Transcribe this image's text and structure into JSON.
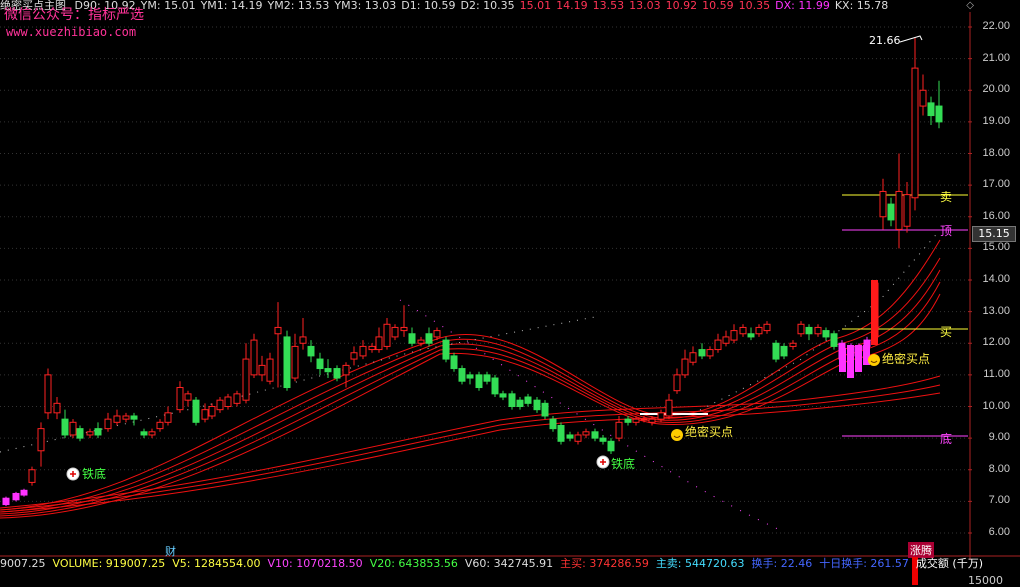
{
  "header": {
    "indicator_name": "绝密买点主图",
    "values": [
      {
        "label": "D90: 10.92",
        "color": "#dddddd"
      },
      {
        "label": "YM: 15.01",
        "color": "#dddddd"
      },
      {
        "label": "YM1: 14.19",
        "color": "#dddddd"
      },
      {
        "label": "YM2: 13.53",
        "color": "#dddddd"
      },
      {
        "label": "YM3: 13.03",
        "color": "#dddddd"
      },
      {
        "label": "D1: 10.59",
        "color": "#dddddd"
      },
      {
        "label": "D2: 10.35",
        "color": "#dddddd"
      },
      {
        "label": "15.01",
        "color": "#ff3355"
      },
      {
        "label": "14.19",
        "color": "#ff3355"
      },
      {
        "label": "13.53",
        "color": "#ff3355"
      },
      {
        "label": "13.03",
        "color": "#ff3355"
      },
      {
        "label": "10.92",
        "color": "#ff3355"
      },
      {
        "label": "10.59",
        "color": "#ff3355"
      },
      {
        "label": "10.35",
        "color": "#ff3355"
      },
      {
        "label": "DX: 11.99",
        "color": "#ff33ff"
      },
      {
        "label": "KX: 15.78",
        "color": "#dddddd"
      }
    ]
  },
  "watermark": {
    "line1": "微信公众号：指标严选",
    "line2": "www.xuezhibiao.com"
  },
  "corner_icon": "diamond-icon",
  "y_axis": {
    "ticks": [
      "22.00",
      "21.00",
      "20.00",
      "19.00",
      "18.00",
      "17.00",
      "16.00",
      "15.00",
      "14.00",
      "13.00",
      "12.00",
      "11.00",
      "10.00",
      "9.00",
      "8.00",
      "7.00",
      "6.00"
    ],
    "current_price": "15.15"
  },
  "annotations": {
    "peak": "21.66",
    "sell": "卖",
    "top": "顶",
    "buy": "买",
    "bottom": "底",
    "tiedi": "铁底",
    "buypoint": "绝密买点"
  },
  "colors": {
    "up": "#ff2222",
    "down": "#33dd55",
    "ma": "#ff1111",
    "magenta": "#ff33ff",
    "yellow": "#ffff33"
  },
  "footer": {
    "items": [
      {
        "label": "9007.25",
        "color": "#dddddd"
      },
      {
        "label": "VOLUME: 919007.25",
        "color": "#ffff44"
      },
      {
        "label": "V5: 1284554.00",
        "color": "#ffff44"
      },
      {
        "label": "V10: 1070218.50",
        "color": "#ff44ff"
      },
      {
        "label": "V20: 643853.56",
        "color": "#44ff44"
      },
      {
        "label": "V60: 342745.91",
        "color": "#dddddd"
      },
      {
        "label": "主买: 374286.59",
        "color": "#ff3333"
      },
      {
        "label": "主卖: 544720.63",
        "color": "#44ddff"
      },
      {
        "label": "换手: 22.46",
        "color": "#4466ff"
      },
      {
        "label": "十日换手: 261.57",
        "color": "#4466ff"
      },
      {
        "label": "成交额 (千万)",
        "color": "#ffffff"
      }
    ],
    "cai": "财",
    "liuteng": "涨腾",
    "vol_tick": "15000"
  }
}
